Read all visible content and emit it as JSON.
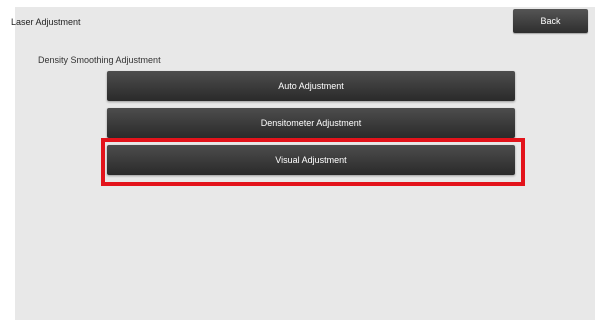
{
  "header": {
    "title": "Laser Adjustment",
    "back_label": "Back"
  },
  "section": {
    "label": "Density Smoothing Adjustment"
  },
  "menu": {
    "items": [
      {
        "label": "Auto Adjustment"
      },
      {
        "label": "Densitometer Adjustment"
      },
      {
        "label": "Visual Adjustment"
      }
    ]
  },
  "colors": {
    "panel_bg": "#e8e8e8",
    "button_bg": "#3a3a3a",
    "highlight": "#e3131b"
  }
}
